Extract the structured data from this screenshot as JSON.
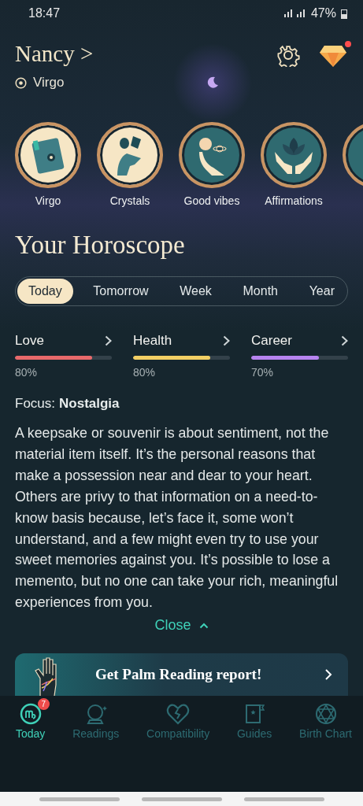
{
  "status_bar": {
    "time": "18:47",
    "battery": "47%"
  },
  "profile": {
    "name": "Nancy",
    "chevron": ">",
    "sign": "Virgo",
    "notification": true
  },
  "stories": [
    {
      "label": "Virgo",
      "kind": "book",
      "light": true
    },
    {
      "label": "Crystals",
      "kind": "crystals",
      "light": true
    },
    {
      "label": "Good vibes",
      "kind": "planets",
      "light": false
    },
    {
      "label": "Affirmations",
      "kind": "lotus",
      "light": false
    }
  ],
  "title": "Your Horoscope",
  "tabs": [
    {
      "label": "Today",
      "selected": true
    },
    {
      "label": "Tomorrow",
      "selected": false
    },
    {
      "label": "Week",
      "selected": false
    },
    {
      "label": "Month",
      "selected": false
    },
    {
      "label": "Year",
      "selected": false
    }
  ],
  "meters": [
    {
      "name": "Love",
      "level": 0.8,
      "reading": "80%",
      "color": "#e8696b"
    },
    {
      "name": "Health",
      "level": 0.8,
      "reading": "80%",
      "color": "#f2cf64"
    },
    {
      "name": "Career",
      "level": 0.7,
      "reading": "70%",
      "color": "#b784f0"
    }
  ],
  "focus": {
    "label": "Focus:",
    "value": "Nostalgia"
  },
  "text": "A keepsake or souvenir is about sentiment, not the material item itself. It’s the personal reasons that make a possession near and dear to your heart. Others are privy to that information on a need-to-know basis because, let’s face it, some won’t understand, and a few might even try to use your sweet memories against you. It’s possible to lose a memento, but no one can take your rich, meaningful experiences from you.",
  "close": "Close",
  "banner": {
    "text": "Get Palm Reading report!"
  },
  "nav": [
    {
      "label": "Today",
      "selected": true,
      "kind": "sign",
      "badge": "7"
    },
    {
      "label": "Readings",
      "selected": false,
      "kind": "ball"
    },
    {
      "label": "Compatibility",
      "selected": false,
      "kind": "heart"
    },
    {
      "label": "Guides",
      "selected": false,
      "kind": "guide"
    },
    {
      "label": "Birth Chart",
      "selected": false,
      "kind": "chart"
    }
  ]
}
